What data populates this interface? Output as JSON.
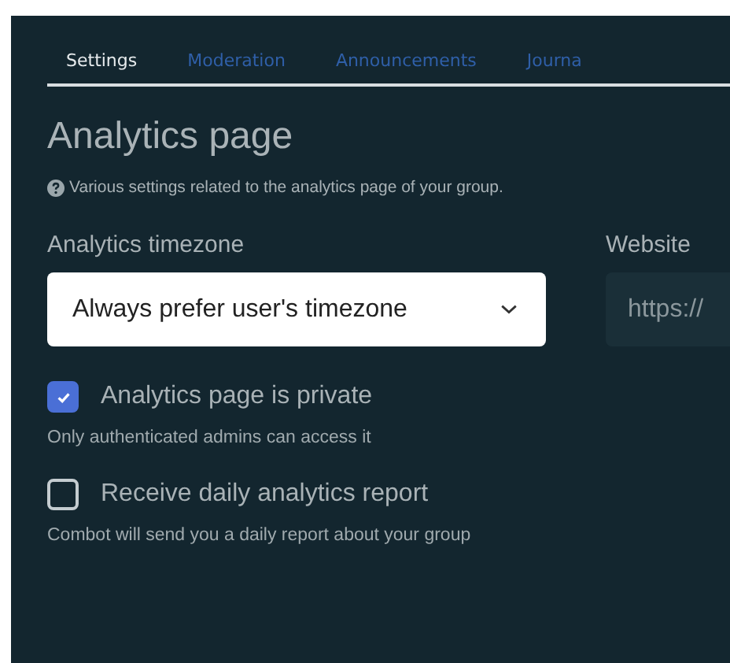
{
  "tabs": [
    {
      "label": "Settings",
      "selected": true
    },
    {
      "label": "Moderation",
      "selected": false
    },
    {
      "label": "Announcements",
      "selected": false
    },
    {
      "label": "Journa",
      "selected": false
    }
  ],
  "section": {
    "title": "Analytics page",
    "description": "Various settings related to the analytics page of your group."
  },
  "timezone": {
    "label": "Analytics timezone",
    "value": "Always prefer user's timezone"
  },
  "website": {
    "label": "Website",
    "value": "https://"
  },
  "options": [
    {
      "label": "Analytics page is private",
      "hint": "Only authenticated admins can access it",
      "checked": true
    },
    {
      "label": "Receive daily analytics report",
      "hint": "Combot will send you a daily report about your group",
      "checked": false
    }
  ]
}
